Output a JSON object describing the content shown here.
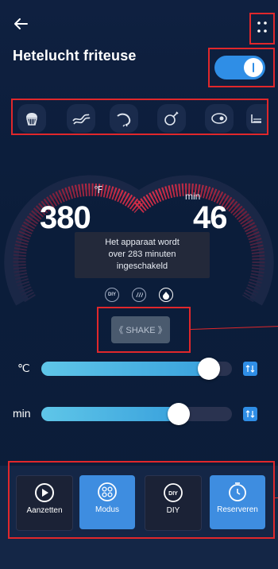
{
  "header": {
    "title": "Hetelucht friteuse"
  },
  "power_toggle": {
    "on": true
  },
  "mode_icons": [
    "cupcake-icon",
    "bacon-icon",
    "shrimp-icon",
    "chicken-leg-icon",
    "steak-icon",
    "fries-icon"
  ],
  "dial": {
    "temp_unit": "℉",
    "temp_value": "380",
    "time_unit": "min",
    "time_value": "46",
    "temp_level": 0.9,
    "time_level": 0.75
  },
  "tooltip": {
    "line1": "Het apparaat wordt",
    "line2": "over 283 minuten",
    "line3": "ingeschakeld"
  },
  "small_icons": {
    "diy": "DIY"
  },
  "shake": {
    "label": "《 SHAKE 》"
  },
  "sliders": [
    {
      "label": "℃",
      "value": 0.88
    },
    {
      "label": "min",
      "value": 0.72
    }
  ],
  "bottom_nav": [
    {
      "label": "Aanzetten",
      "icon": "play-icon",
      "active": false
    },
    {
      "label": "Modus",
      "icon": "grid-icon",
      "active": true
    },
    {
      "label": "DIY",
      "icon": "diy-icon",
      "active": false
    },
    {
      "label": "Reserveren",
      "icon": "timer-icon",
      "active": true
    }
  ],
  "colors": {
    "accent": "#2f8ee6",
    "highlight": "#e0272b",
    "background": "#0d1b33"
  }
}
